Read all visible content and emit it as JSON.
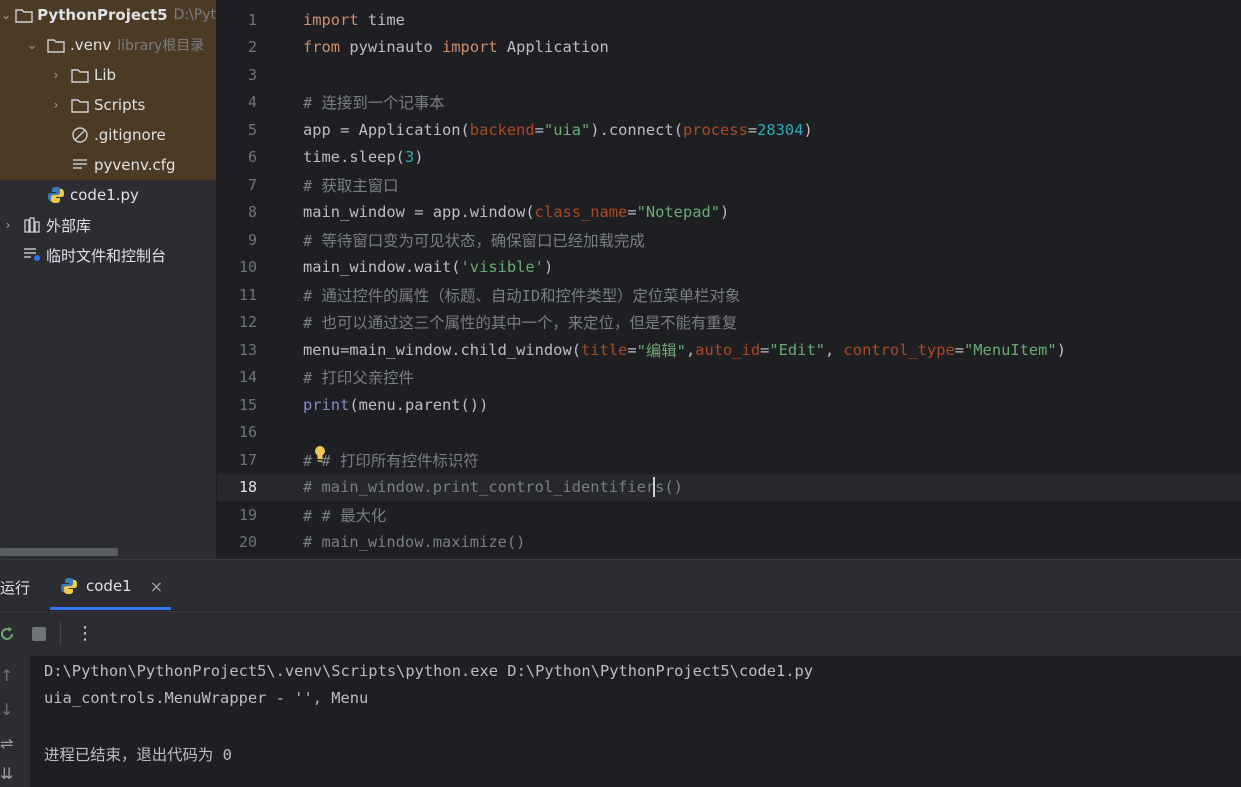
{
  "project_tree": {
    "root": {
      "name": "PythonProject5",
      "path_hint": "D:\\Pyt"
    },
    "items": [
      {
        "label": "PythonProject5",
        "hint": "D:\\Pyt",
        "icon": "folder-icon"
      },
      {
        "label": ".venv",
        "hint": "library根目录",
        "icon": "folder-icon"
      },
      {
        "label": "Lib",
        "hint": "",
        "icon": "folder-icon"
      },
      {
        "label": "Scripts",
        "hint": "",
        "icon": "folder-icon"
      },
      {
        "label": ".gitignore",
        "hint": "",
        "icon": "ignore-file-icon"
      },
      {
        "label": "pyvenv.cfg",
        "hint": "",
        "icon": "text-file-icon"
      },
      {
        "label": "code1.py",
        "hint": "",
        "icon": "python-file-icon"
      },
      {
        "label": "外部库",
        "hint": "",
        "icon": "library-icon"
      },
      {
        "label": "临时文件和控制台",
        "hint": "",
        "icon": "scratches-icon"
      }
    ]
  },
  "editor": {
    "current_line": 18,
    "line_numbers": [
      "1",
      "2",
      "3",
      "4",
      "5",
      "6",
      "7",
      "8",
      "9",
      "10",
      "11",
      "12",
      "13",
      "14",
      "15",
      "16",
      "17",
      "18",
      "19",
      "20"
    ],
    "lines": [
      [
        {
          "t": "import",
          "c": "kw"
        },
        {
          "t": " time",
          "c": "fn"
        }
      ],
      [
        {
          "t": "from",
          "c": "kw"
        },
        {
          "t": " pywinauto ",
          "c": "fn"
        },
        {
          "t": "import",
          "c": "kw"
        },
        {
          "t": " Application",
          "c": "fn"
        }
      ],
      [],
      [
        {
          "t": "# 连接到一个记事本",
          "c": "cmt"
        }
      ],
      [
        {
          "t": "app = Application(",
          "c": "fn"
        },
        {
          "t": "backend",
          "c": "param"
        },
        {
          "t": "=",
          "c": "fn"
        },
        {
          "t": "\"uia\"",
          "c": "str"
        },
        {
          "t": ").connect(",
          "c": "fn"
        },
        {
          "t": "process",
          "c": "param"
        },
        {
          "t": "=",
          "c": "fn"
        },
        {
          "t": "28304",
          "c": "num"
        },
        {
          "t": ")",
          "c": "fn"
        }
      ],
      [
        {
          "t": "time.sleep(",
          "c": "fn"
        },
        {
          "t": "3",
          "c": "num"
        },
        {
          "t": ")",
          "c": "fn"
        }
      ],
      [
        {
          "t": "# 获取主窗口",
          "c": "cmt"
        }
      ],
      [
        {
          "t": "main_window = app.window(",
          "c": "fn"
        },
        {
          "t": "class_name",
          "c": "param"
        },
        {
          "t": "=",
          "c": "fn"
        },
        {
          "t": "\"Notepad\"",
          "c": "str"
        },
        {
          "t": ")",
          "c": "fn"
        }
      ],
      [
        {
          "t": "# 等待窗口变为可见状态，确保窗口已经加载完成",
          "c": "cmt"
        }
      ],
      [
        {
          "t": "main_window.wait(",
          "c": "fn"
        },
        {
          "t": "'visible'",
          "c": "str"
        },
        {
          "t": ")",
          "c": "fn"
        }
      ],
      [
        {
          "t": "# 通过控件的属性（标题、自动ID和控件类型）定位菜单栏对象",
          "c": "cmt"
        }
      ],
      [
        {
          "t": "# 也可以通过这三个属性的其中一个，来定位，但是不能有重复",
          "c": "cmt"
        }
      ],
      [
        {
          "t": "menu=main_window.child_window(",
          "c": "fn"
        },
        {
          "t": "title",
          "c": "param"
        },
        {
          "t": "=",
          "c": "fn"
        },
        {
          "t": "\"编辑\"",
          "c": "str"
        },
        {
          "t": ",",
          "c": "fn"
        },
        {
          "t": "auto_id",
          "c": "param"
        },
        {
          "t": "=",
          "c": "fn"
        },
        {
          "t": "\"Edit\"",
          "c": "str"
        },
        {
          "t": ", ",
          "c": "fn"
        },
        {
          "t": "control_type",
          "c": "param"
        },
        {
          "t": "=",
          "c": "fn"
        },
        {
          "t": "\"MenuItem\"",
          "c": "str"
        },
        {
          "t": ")",
          "c": "fn"
        }
      ],
      [
        {
          "t": "# 打印父亲控件",
          "c": "cmt"
        }
      ],
      [
        {
          "t": "print",
          "c": "builtin"
        },
        {
          "t": "(menu.parent())",
          "c": "fn"
        }
      ],
      [],
      [
        {
          "t": "# # 打印所有控件标识符",
          "c": "cmt"
        }
      ],
      [
        {
          "t": "# main_window.print_control_identifiers()",
          "c": "cmt"
        }
      ],
      [
        {
          "t": "# # 最大化",
          "c": "cmt"
        }
      ],
      [
        {
          "t": "# main_window.maximize()",
          "c": "cmt"
        }
      ]
    ]
  },
  "run_panel": {
    "title": "运行",
    "tab_label": "code1",
    "tab_close": "×",
    "output": [
      "D:\\Python\\PythonProject5\\.venv\\Scripts\\python.exe D:\\Python\\PythonProject5\\code1.py",
      "uia_controls.MenuWrapper - '', Menu",
      "",
      "进程已结束，退出代码为 0"
    ]
  },
  "colors": {
    "accent": "#3574f0",
    "keyword": "#cf8e6d",
    "string": "#6aab73",
    "number": "#2aacb8",
    "param": "#aa4926",
    "comment": "#7a7e85"
  }
}
